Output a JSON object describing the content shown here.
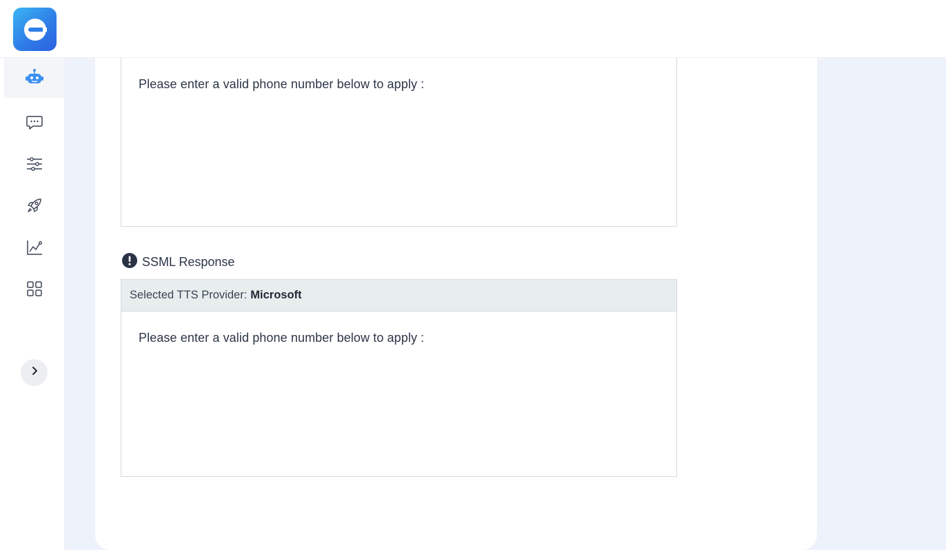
{
  "sidebar": {
    "items": [
      {
        "icon": "robot-icon",
        "active": true
      },
      {
        "icon": "chat-icon",
        "active": false
      },
      {
        "icon": "sliders-icon",
        "active": false
      },
      {
        "icon": "rocket-icon",
        "active": false
      },
      {
        "icon": "analytics-icon",
        "active": false
      },
      {
        "icon": "grid-icon",
        "active": false
      }
    ],
    "expand_icon": "chevron-right-icon"
  },
  "brand": {
    "logo_icon": "app-logo-icon",
    "accent": "#2f7fe8"
  },
  "main": {
    "response_box": {
      "text": "Please enter a valid phone number below to apply :"
    },
    "ssml_section": {
      "label": "SSML Response",
      "info_icon": "alert-circle-icon",
      "provider_label": "Selected TTS Provider:",
      "provider_value": "Microsoft",
      "text": "Please enter a valid phone number below to apply :"
    }
  }
}
